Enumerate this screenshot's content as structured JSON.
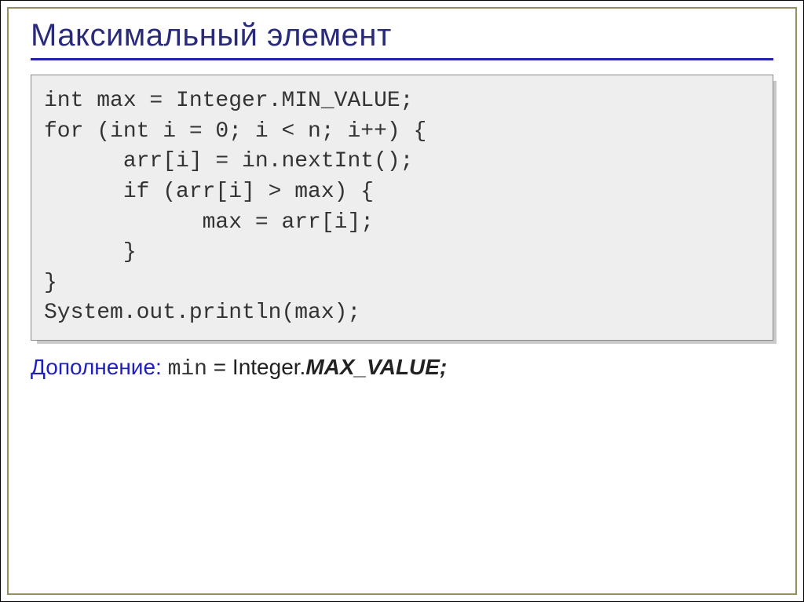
{
  "slide": {
    "title": "Максимальный элемент",
    "code": "int max = Integer.MIN_VALUE;\nfor (int i = 0; i < n; i++) {\n      arr[i] = in.nextInt();\n      if (arr[i] > max) {\n            max = arr[i];\n      }\n}\nSystem.out.println(max);",
    "note": {
      "label": "Дополнение:",
      "code_prefix": "min",
      "equals": " = ",
      "serif": "Integer.",
      "bolditalic": "MAX_VALUE;"
    }
  }
}
